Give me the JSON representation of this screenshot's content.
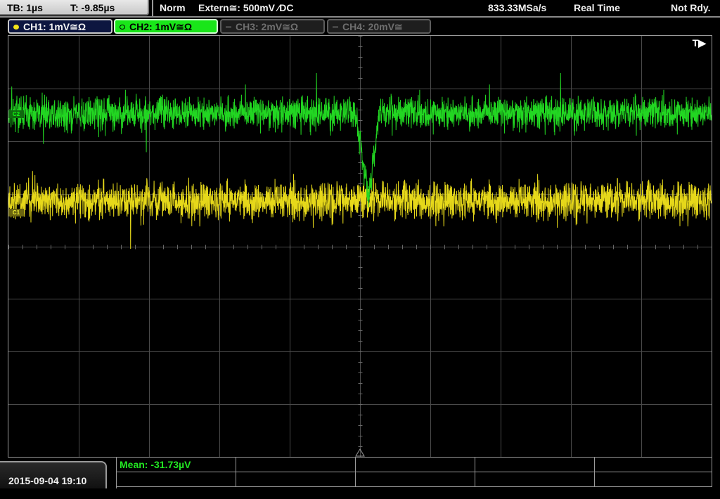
{
  "timebase": {
    "tb": "TB: 1µs",
    "trigger_time": "T: -9.85µs"
  },
  "status": {
    "mode": "Norm",
    "trigger_source": "Extern≅: 500mV ⁄DC",
    "sample_rate": "833.33MSa/s",
    "acquisition": "Real Time",
    "state": "Not Rdy."
  },
  "channels": [
    {
      "label": "CH1: 1mV≅Ω",
      "color": "#f2e31a",
      "active": true
    },
    {
      "label": "CH2: 1mV≅Ω",
      "color": "#19e619",
      "active": true,
      "selected": true
    },
    {
      "label": "CH3: 2mV≅Ω",
      "color": "#6f6f6f",
      "active": false
    },
    {
      "label": "CH4: 20mV≅",
      "color": "#6f6f6f",
      "active": false
    }
  ],
  "screen": {
    "trigger_marker": "T▶",
    "ch2_marker": "C2",
    "ch1_marker": "C1",
    "grid_divisions": {
      "horizontal": 10,
      "vertical": 8
    }
  },
  "footer": {
    "datetime": "2015-09-04 19:10",
    "measurement": "Mean: -31.73µV"
  },
  "colors": {
    "ch1": "#e6d81a",
    "ch2": "#22d622",
    "grid": "#5a5a5a",
    "background": "#000000"
  }
}
